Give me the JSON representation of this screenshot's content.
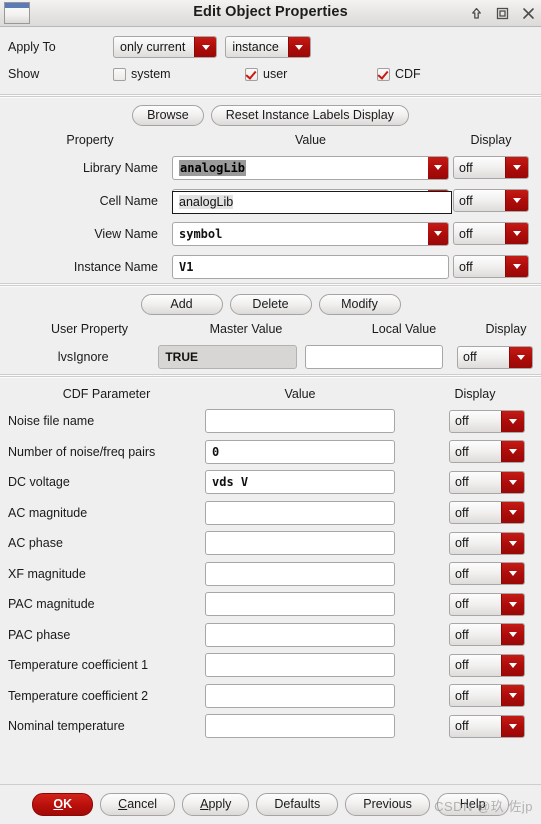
{
  "window": {
    "title": "Edit Object Properties",
    "controls": [
      {
        "name": "shade-up-icon",
        "glyph": "up-arrow"
      },
      {
        "name": "maximize-icon",
        "glyph": "square"
      },
      {
        "name": "close-icon",
        "glyph": "x"
      }
    ]
  },
  "apply_to": {
    "label": "Apply To",
    "scope_value": "only current",
    "object_value": "instance"
  },
  "show": {
    "label": "Show",
    "options": [
      {
        "label": "system",
        "checked": false
      },
      {
        "label": "user",
        "checked": true
      },
      {
        "label": "CDF",
        "checked": true
      }
    ]
  },
  "property_section": {
    "buttons": [
      {
        "label": "Browse"
      },
      {
        "label": "Reset Instance Labels Display"
      }
    ],
    "headers": {
      "property": "Property",
      "value": "Value",
      "display": "Display"
    },
    "rows": [
      {
        "name": "Library Name",
        "value": "analogLib",
        "display": "off",
        "has_arrow": true,
        "selected": true
      },
      {
        "name": "Cell Name",
        "value": "",
        "display": "off",
        "has_arrow": true,
        "selected": false
      },
      {
        "name": "View Name",
        "value": "symbol",
        "display": "off",
        "has_arrow": true,
        "selected": false
      },
      {
        "name": "Instance Name",
        "value": "V1",
        "display": "off",
        "has_arrow": false,
        "selected": false
      }
    ],
    "suggestion": {
      "text": "analogLib"
    }
  },
  "user_property_section": {
    "buttons": [
      {
        "label": "Add"
      },
      {
        "label": "Delete"
      },
      {
        "label": "Modify"
      }
    ],
    "headers": {
      "user_property": "User Property",
      "master_value": "Master Value",
      "local_value": "Local Value",
      "display": "Display"
    },
    "rows": [
      {
        "name": "lvsIgnore",
        "master_value": "TRUE",
        "local_value": "",
        "display": "off"
      }
    ]
  },
  "cdf_section": {
    "headers": {
      "parameter": "CDF Parameter",
      "value": "Value",
      "display": "Display"
    },
    "rows": [
      {
        "name": "Noise file name",
        "value": "",
        "display": "off"
      },
      {
        "name": "Number of noise/freq pairs",
        "value": "0",
        "display": "off"
      },
      {
        "name": "DC voltage",
        "value": "vds V",
        "display": "off"
      },
      {
        "name": "AC magnitude",
        "value": "",
        "display": "off"
      },
      {
        "name": "AC phase",
        "value": "",
        "display": "off"
      },
      {
        "name": "XF magnitude",
        "value": "",
        "display": "off"
      },
      {
        "name": "PAC magnitude",
        "value": "",
        "display": "off"
      },
      {
        "name": "PAC phase",
        "value": "",
        "display": "off"
      },
      {
        "name": "Temperature coefficient 1",
        "value": "",
        "display": "off"
      },
      {
        "name": "Temperature coefficient 2",
        "value": "",
        "display": "off"
      },
      {
        "name": "Nominal temperature",
        "value": "",
        "display": "off"
      }
    ]
  },
  "bottom_bar": {
    "ok": {
      "pre": "",
      "mn": "O",
      "post": "K"
    },
    "cancel": {
      "mn": "C",
      "post": "ancel"
    },
    "apply": {
      "mn": "A",
      "post": "pply"
    },
    "defaults": "Defaults",
    "previous": "Previous",
    "help": "Help"
  },
  "watermark": {
    "text": "CSDN @玖 佐jp"
  },
  "colors": {
    "accent_red": "#ad0d0b",
    "ok_red": "#bb100c",
    "window_bg": "#efefef",
    "field_bg": "#ffffff",
    "readonly_bg": "#d8d6d4",
    "selection_gray": "#9a9a9a"
  }
}
